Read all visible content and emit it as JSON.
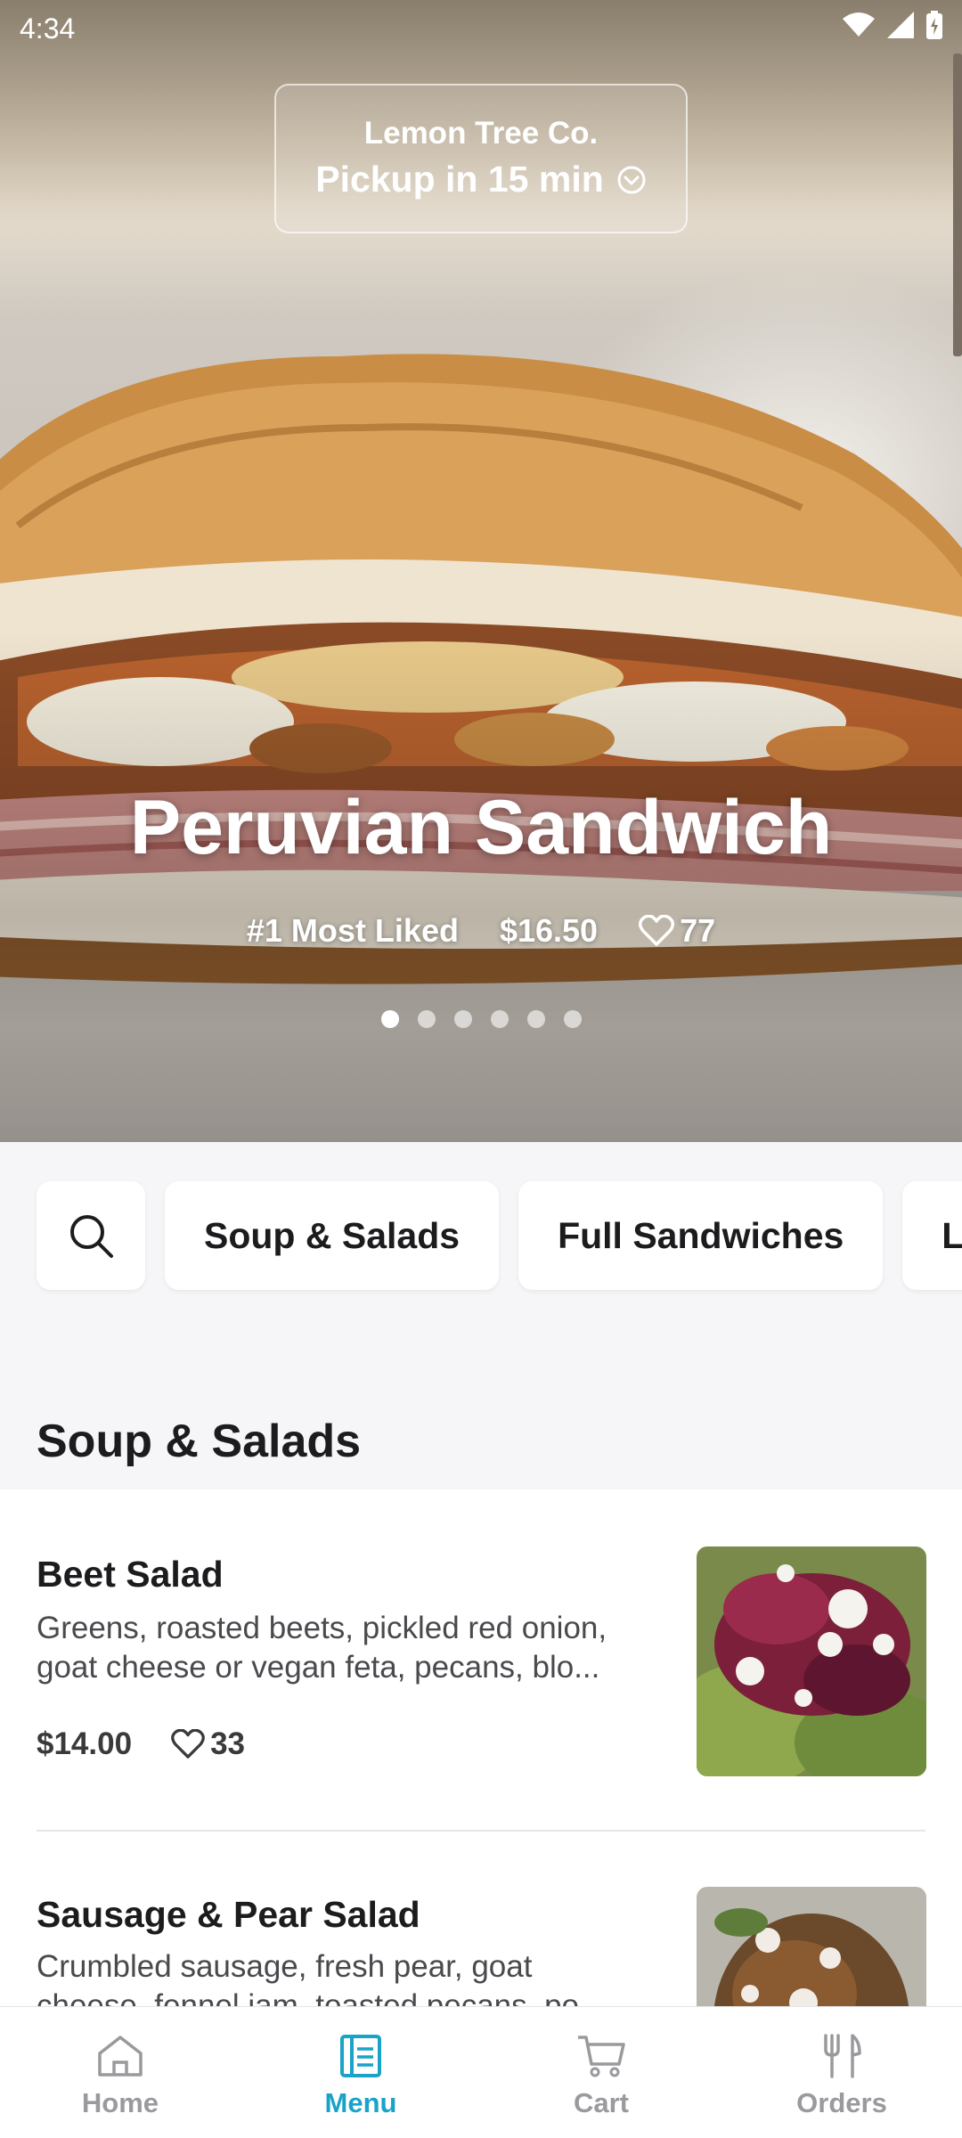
{
  "status_bar": {
    "time": "4:34"
  },
  "store": {
    "name": "Lemon Tree Co.",
    "pickup": "Pickup in 15 min"
  },
  "featured": {
    "title": "Peruvian Sandwich",
    "rank": "#1 Most Liked",
    "price": "$16.50",
    "likes": "77",
    "carousel_count": 6,
    "carousel_active": 0
  },
  "categories": [
    "Soup & Salads",
    "Full Sandwiches",
    "L"
  ],
  "section": {
    "title": "Soup & Salads"
  },
  "items": [
    {
      "name": "Beet Salad",
      "desc_line1": "Greens, roasted beets, pickled red onion,",
      "desc_line2": "goat cheese or vegan feta, pecans, blo...",
      "price": "$14.00",
      "likes": "33"
    },
    {
      "name": "Sausage & Pear Salad",
      "desc_line1": "Crumbled sausage, fresh pear, goat",
      "desc_line2": "cheese, fennel jam, toasted pecans, po..."
    }
  ],
  "nav": [
    {
      "label": "Home",
      "icon": "home-icon"
    },
    {
      "label": "Menu",
      "icon": "menu-icon",
      "active": true
    },
    {
      "label": "Cart",
      "icon": "cart-icon"
    },
    {
      "label": "Orders",
      "icon": "utensils-icon"
    }
  ],
  "colors": {
    "accent": "#1aa3c9",
    "nav_inactive": "#9a9a9e"
  }
}
